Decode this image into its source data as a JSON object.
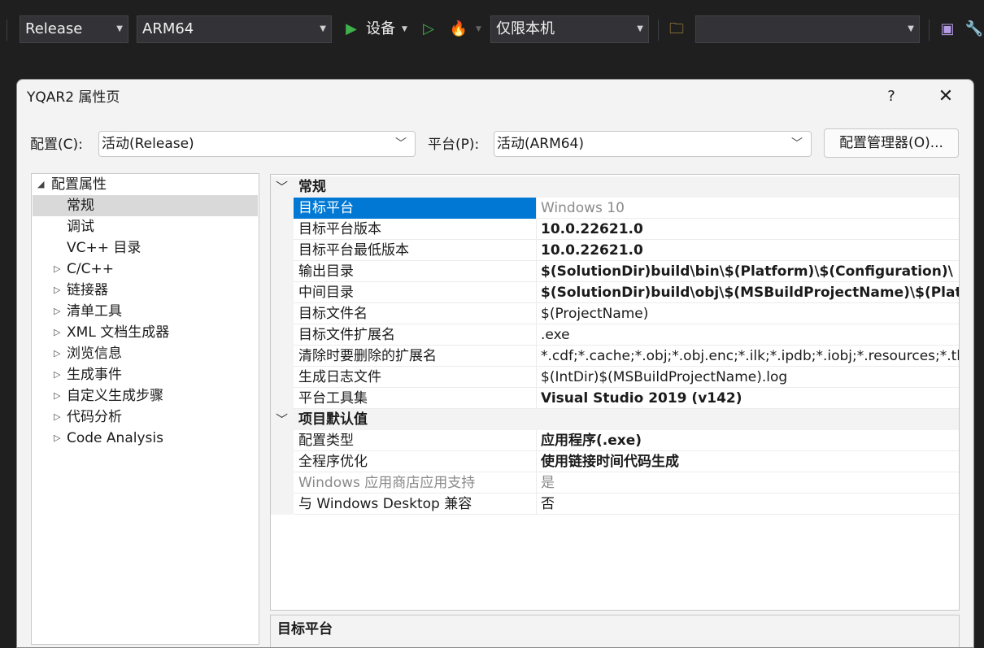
{
  "toolbar": {
    "config_combo": "Release",
    "platform_combo": "ARM64",
    "run_label": "设备",
    "target_combo": "仅限本机",
    "search_combo": ""
  },
  "dialog": {
    "title": "YQAR2 属性页",
    "help": "?",
    "close": "✕",
    "config_label": "配置(C):",
    "config_value": "活动(Release)",
    "platform_label": "平台(P):",
    "platform_value": "活动(ARM64)",
    "manager_button": "配置管理器(O)..."
  },
  "tree": {
    "root": "配置属性",
    "items": [
      {
        "label": "常规"
      },
      {
        "label": "调试"
      },
      {
        "label": "VC++ 目录"
      },
      {
        "label": "C/C++"
      },
      {
        "label": "链接器"
      },
      {
        "label": "清单工具"
      },
      {
        "label": "XML 文档生成器"
      },
      {
        "label": "浏览信息"
      },
      {
        "label": "生成事件"
      },
      {
        "label": "自定义生成步骤"
      },
      {
        "label": "代码分析"
      },
      {
        "label": "Code Analysis"
      }
    ]
  },
  "grid": {
    "category_general": "常规",
    "general": [
      {
        "name": "目标平台",
        "value": "Windows 10"
      },
      {
        "name": "目标平台版本",
        "value": "10.0.22621.0"
      },
      {
        "name": "目标平台最低版本",
        "value": "10.0.22621.0"
      },
      {
        "name": "输出目录",
        "value": "$(SolutionDir)build\\bin\\$(Platform)\\$(Configuration)\\"
      },
      {
        "name": "中间目录",
        "value": "$(SolutionDir)build\\obj\\$(MSBuildProjectName)\\$(Platform)\\$(Configuration)\\"
      },
      {
        "name": "目标文件名",
        "value": "$(ProjectName)"
      },
      {
        "name": "目标文件扩展名",
        "value": ".exe"
      },
      {
        "name": "清除时要删除的扩展名",
        "value": "*.cdf;*.cache;*.obj;*.obj.enc;*.ilk;*.ipdb;*.iobj;*.resources;*.tlb;*.tli;*.tlh;*.tmp"
      },
      {
        "name": "生成日志文件",
        "value": "$(IntDir)$(MSBuildProjectName).log"
      },
      {
        "name": "平台工具集",
        "value": "Visual Studio 2019 (v142)"
      }
    ],
    "category_defaults": "项目默认值",
    "defaults": [
      {
        "name": "配置类型",
        "value": "应用程序(.exe)"
      },
      {
        "name": "全程序优化",
        "value": "使用链接时间代码生成"
      },
      {
        "name": "Windows 应用商店应用支持",
        "value": "是"
      },
      {
        "name": "与 Windows Desktop 兼容",
        "value": "否"
      }
    ]
  },
  "description": {
    "title": "目标平台"
  }
}
